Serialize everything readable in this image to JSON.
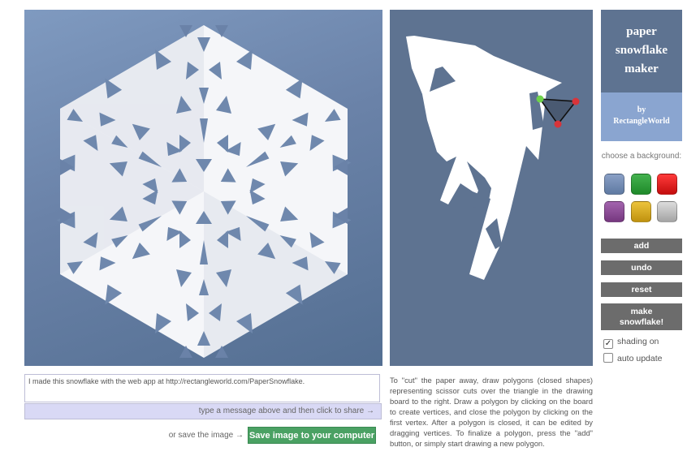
{
  "app": {
    "title_lines": [
      "paper",
      "snowflake",
      "maker"
    ],
    "by_label": "by",
    "author": "RectangleWorld"
  },
  "message": {
    "text": "I made this snowflake with the web app at http://rectangleworld.com/PaperSnowflake."
  },
  "share": {
    "label": "type a message above and then click to share →"
  },
  "save": {
    "hint": "or save the image →",
    "button_label": "Save image to your computer"
  },
  "instructions": "To \"cut\" the paper away, draw polygons (closed shapes) representing scissor cuts over the triangle in the drawing board to the right. Draw a polygon by clicking on the board to create vertices, and close the polygon by clicking on the first vertex. After a polygon is closed, it can be edited by dragging vertices. To finalize a polygon, press the \"add\" button, or simply start drawing a new polygon.",
  "background": {
    "label": "choose a background:",
    "swatches": [
      {
        "name": "blue",
        "color": "#6a82a8"
      },
      {
        "name": "green",
        "color": "#2e9a3a"
      },
      {
        "name": "red",
        "color": "#e01818"
      },
      {
        "name": "purple",
        "color": "#8a4a95"
      },
      {
        "name": "gold",
        "color": "#d6a81c"
      },
      {
        "name": "gray",
        "color": "#bdbdbd"
      }
    ]
  },
  "controls": {
    "add": "add",
    "undo": "undo",
    "reset": "reset",
    "make": "make snowflake!"
  },
  "options": {
    "shading_label": "shading on",
    "shading_checked": true,
    "auto_update_label": "auto update",
    "auto_update_checked": false
  },
  "colors": {
    "display_bg": "#6a82a8",
    "board_bg": "#5e7391",
    "title_bg": "#5e7391",
    "byline_bg": "#8aa5d0",
    "button_bg": "#6c6c6c",
    "save_button_bg": "#4aa163"
  }
}
